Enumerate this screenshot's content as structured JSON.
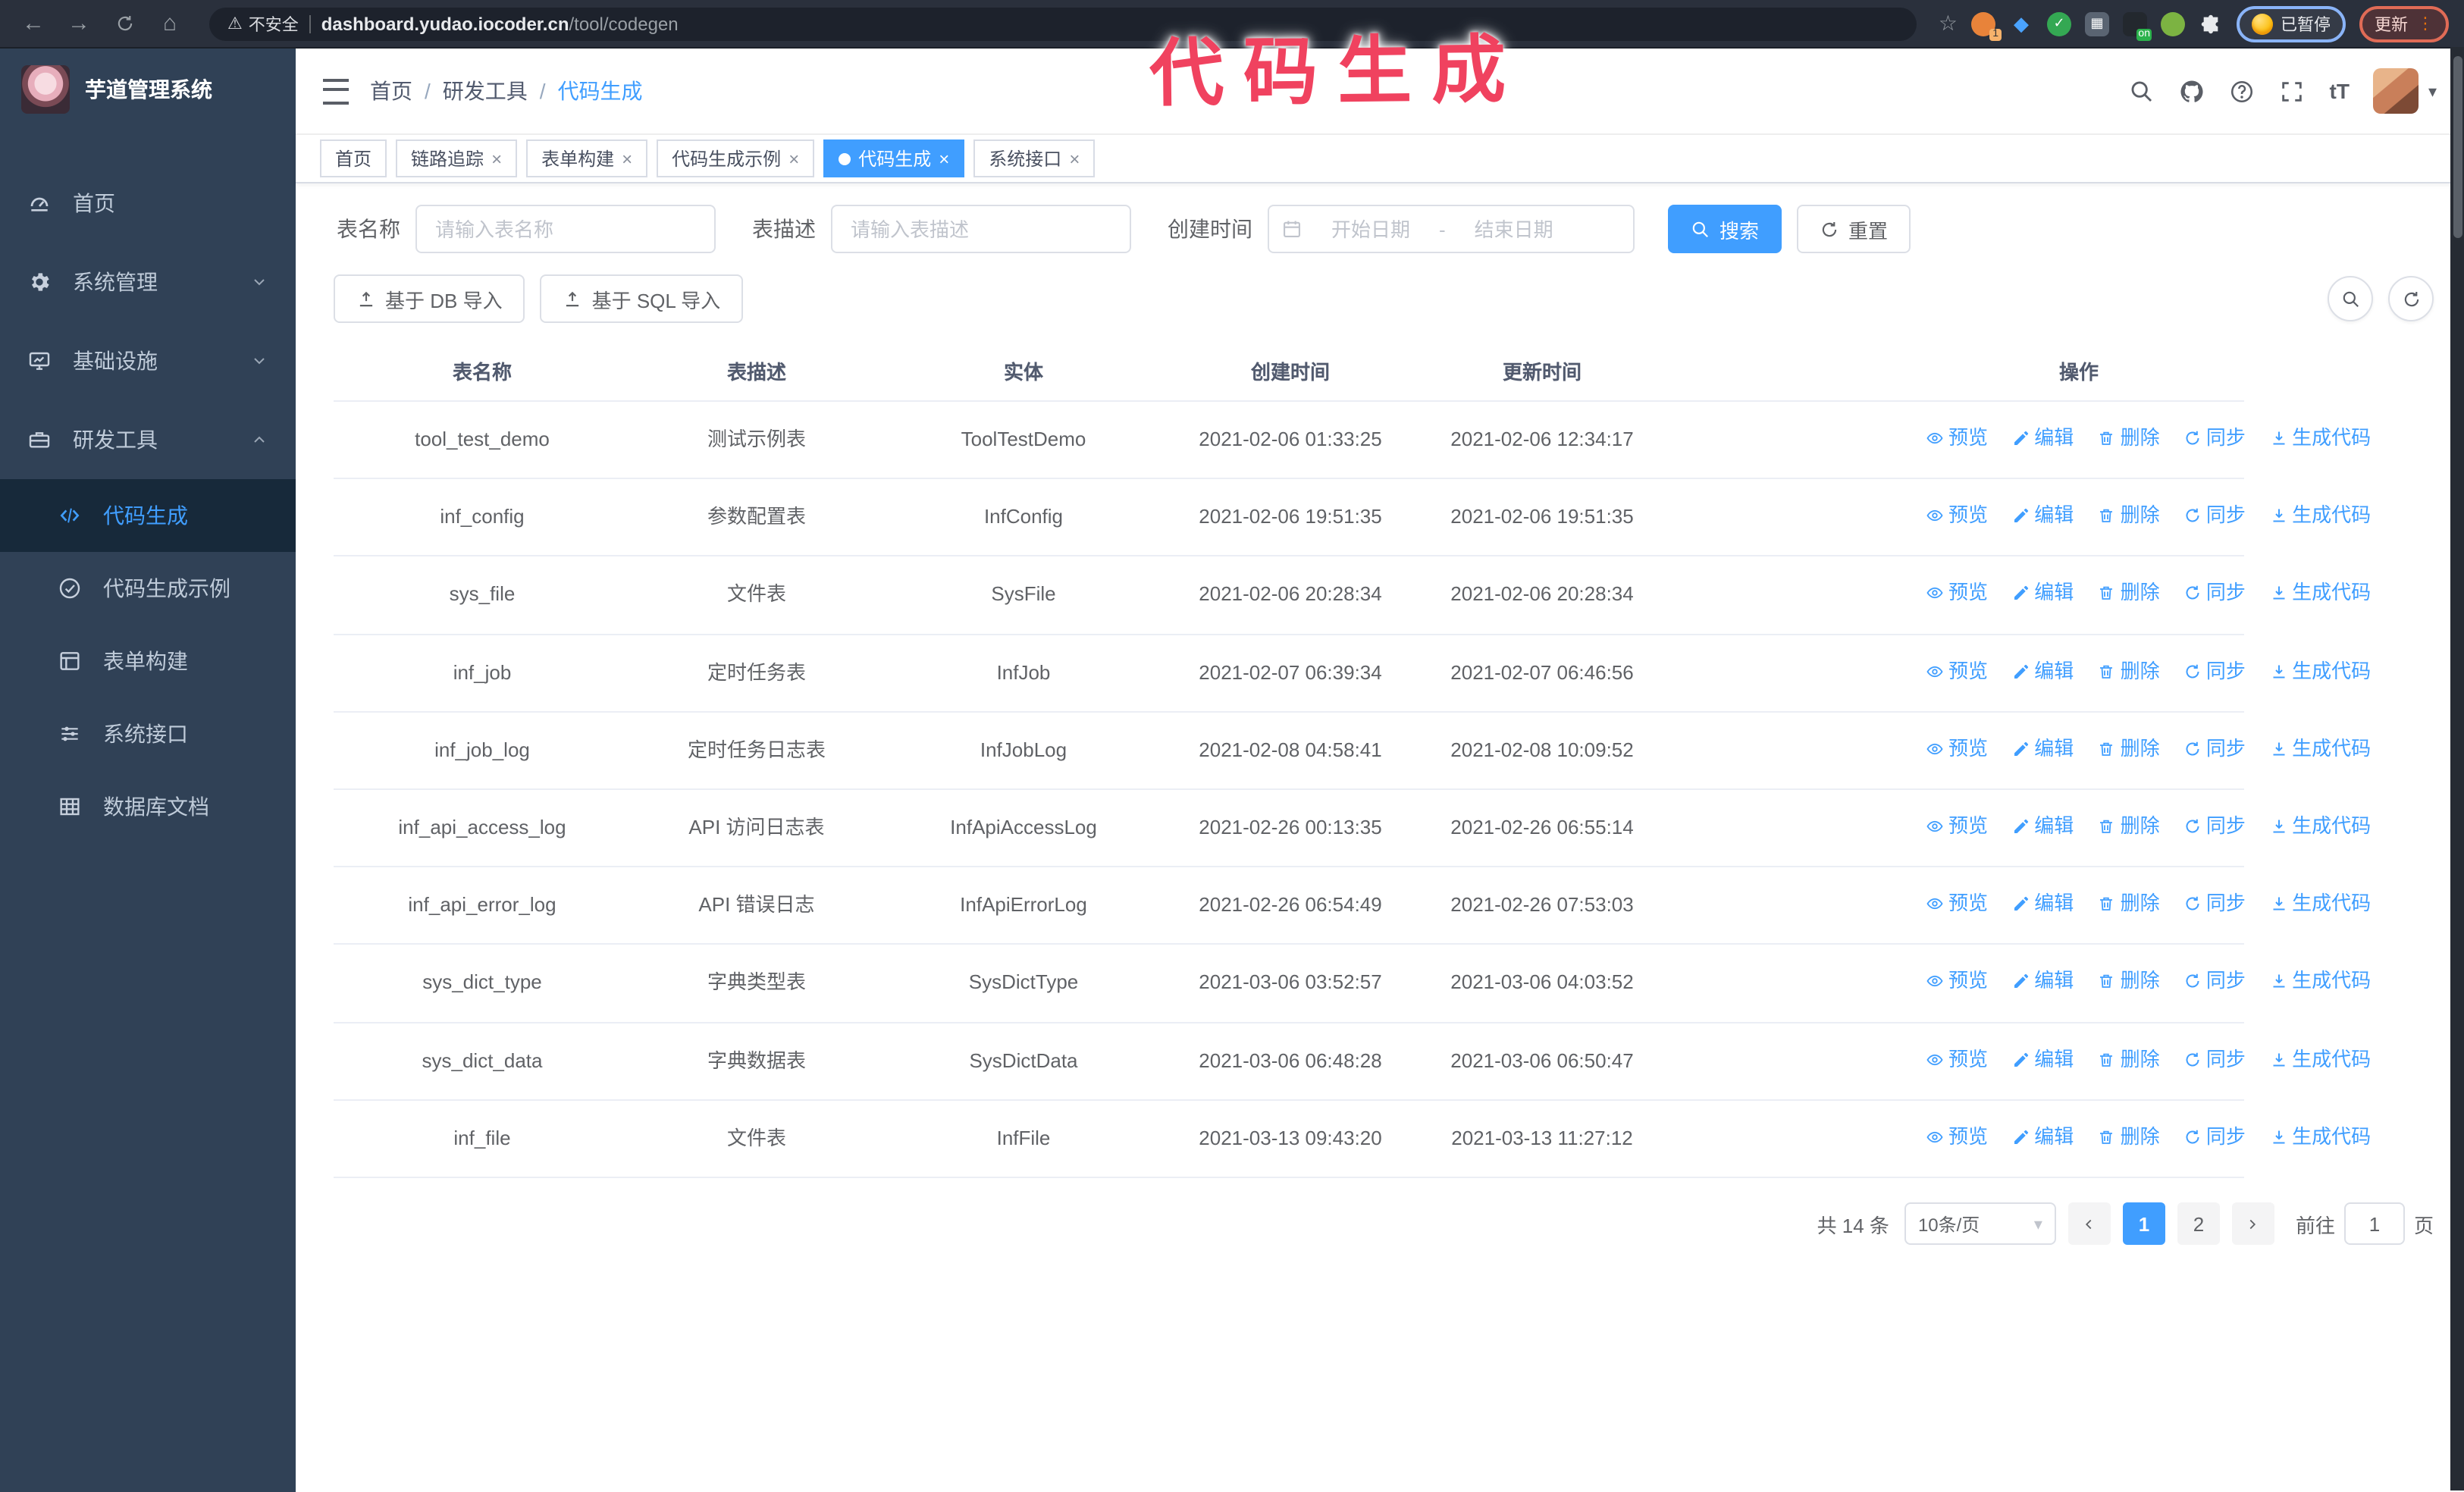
{
  "browser": {
    "security_label": "不安全",
    "url_host": "dashboard.yudao.iocoder.cn",
    "url_path": "/tool/codegen",
    "profile_status": "已暂停",
    "update_label": "更新",
    "extension_badge": "1",
    "extension_on_badge": "on"
  },
  "annotation": {
    "text": "代码生成"
  },
  "icons": {
    "back": "←",
    "forward": "→",
    "home": "⌂",
    "warning": "⚠",
    "star": "☆",
    "more_vertical": "⋮",
    "caret_down": "▾"
  },
  "sidebar": {
    "logo_title": "芋道管理系统",
    "menu": [
      {
        "label": "首页"
      },
      {
        "label": "系统管理"
      },
      {
        "label": "基础设施"
      },
      {
        "label": "研发工具"
      }
    ],
    "submenu": [
      {
        "label": "代码生成"
      },
      {
        "label": "代码生成示例"
      },
      {
        "label": "表单构建"
      },
      {
        "label": "系统接口"
      },
      {
        "label": "数据库文档"
      }
    ]
  },
  "navbar": {
    "breadcrumb": [
      "首页",
      "研发工具",
      "代码生成"
    ],
    "separator": "/"
  },
  "tabs": [
    {
      "label": "首页"
    },
    {
      "label": "链路追踪"
    },
    {
      "label": "表单构建"
    },
    {
      "label": "代码生成示例"
    },
    {
      "label": "代码生成"
    },
    {
      "label": "系统接口"
    }
  ],
  "filters": {
    "table_name_label": "表名称",
    "table_name_placeholder": "请输入表名称",
    "table_desc_label": "表描述",
    "table_desc_placeholder": "请输入表描述",
    "create_time_label": "创建时间",
    "date_start_placeholder": "开始日期",
    "date_separator": "-",
    "date_end_placeholder": "结束日期",
    "search_label": "搜索",
    "reset_label": "重置"
  },
  "toolbar": {
    "import_db_label": "基于 DB 导入",
    "import_sql_label": "基于 SQL 导入"
  },
  "table": {
    "columns": [
      "表名称",
      "表描述",
      "实体",
      "创建时间",
      "更新时间",
      "操作"
    ],
    "actions": [
      "预览",
      "编辑",
      "删除",
      "同步",
      "生成代码"
    ],
    "rows": [
      {
        "name": "tool_test_demo",
        "desc": "测试示例表",
        "entity": "ToolTestDemo",
        "created": "2021-02-06 01:33:25",
        "updated": "2021-02-06 12:34:17"
      },
      {
        "name": "inf_config",
        "desc": "参数配置表",
        "entity": "InfConfig",
        "created": "2021-02-06 19:51:35",
        "updated": "2021-02-06 19:51:35"
      },
      {
        "name": "sys_file",
        "desc": "文件表",
        "entity": "SysFile",
        "created": "2021-02-06 20:28:34",
        "updated": "2021-02-06 20:28:34"
      },
      {
        "name": "inf_job",
        "desc": "定时任务表",
        "entity": "InfJob",
        "created": "2021-02-07 06:39:34",
        "updated": "2021-02-07 06:46:56"
      },
      {
        "name": "inf_job_log",
        "desc": "定时任务日志表",
        "entity": "InfJobLog",
        "created": "2021-02-08 04:58:41",
        "updated": "2021-02-08 10:09:52"
      },
      {
        "name": "inf_api_access_log",
        "desc": "API 访问日志表",
        "entity": "InfApiAccessLog",
        "created": "2021-02-26 00:13:35",
        "updated": "2021-02-26 06:55:14"
      },
      {
        "name": "inf_api_error_log",
        "desc": "API 错误日志",
        "entity": "InfApiErrorLog",
        "created": "2021-02-26 06:54:49",
        "updated": "2021-02-26 07:53:03"
      },
      {
        "name": "sys_dict_type",
        "desc": "字典类型表",
        "entity": "SysDictType",
        "created": "2021-03-06 03:52:57",
        "updated": "2021-03-06 04:03:52"
      },
      {
        "name": "sys_dict_data",
        "desc": "字典数据表",
        "entity": "SysDictData",
        "created": "2021-03-06 06:48:28",
        "updated": "2021-03-06 06:50:47"
      },
      {
        "name": "inf_file",
        "desc": "文件表",
        "entity": "InfFile",
        "created": "2021-03-13 09:43:20",
        "updated": "2021-03-13 11:27:12"
      }
    ]
  },
  "pagination": {
    "total_label": "共 14 条",
    "page_size_label": "10条/页",
    "pages": [
      "1",
      "2"
    ],
    "active_page": "1",
    "goto_label": "前往",
    "goto_value": "1",
    "goto_suffix": "页"
  },
  "colors": {
    "accent": "#409eff",
    "sidebar_bg": "#304156",
    "annotation": "#f0425f",
    "chrome_bg": "#2a303c"
  }
}
